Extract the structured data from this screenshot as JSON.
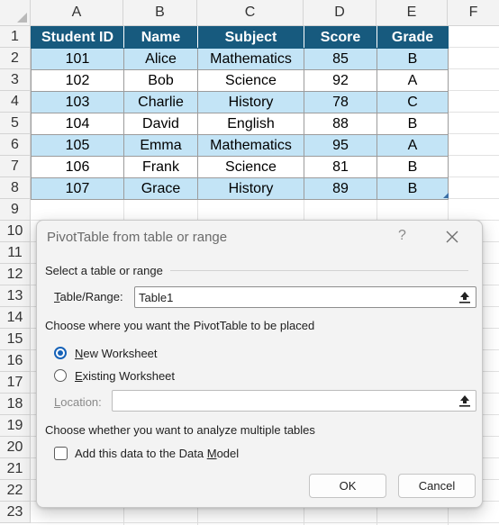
{
  "sheet": {
    "columns": [
      "A",
      "B",
      "C",
      "D",
      "E",
      "F"
    ],
    "rows": [
      "1",
      "2",
      "3",
      "4",
      "5",
      "6",
      "7",
      "8",
      "9",
      "10",
      "11",
      "12",
      "13",
      "14",
      "15",
      "16",
      "17",
      "18",
      "19",
      "20",
      "21",
      "22",
      "23"
    ]
  },
  "table": {
    "headers": [
      "Student ID",
      "Name",
      "Subject",
      "Score",
      "Grade"
    ],
    "rows": [
      [
        "101",
        "Alice",
        "Mathematics",
        "85",
        "B"
      ],
      [
        "102",
        "Bob",
        "Science",
        "92",
        "A"
      ],
      [
        "103",
        "Charlie",
        "History",
        "78",
        "C"
      ],
      [
        "104",
        "David",
        "English",
        "88",
        "B"
      ],
      [
        "105",
        "Emma",
        "Mathematics",
        "95",
        "A"
      ],
      [
        "106",
        "Frank",
        "Science",
        "81",
        "B"
      ],
      [
        "107",
        "Grace",
        "History",
        "89",
        "B"
      ]
    ],
    "header_color": "#175a7e",
    "band_color": "#c3e4f6"
  },
  "dialog": {
    "title": "PivotTable from table or range",
    "help": "?",
    "section_source": "Select a table or range",
    "table_range_label_pre": "",
    "table_range_label_key": "T",
    "table_range_label_post": "able/Range:",
    "table_range_value": "Table1",
    "section_placement": "Choose where you want the PivotTable to be placed",
    "new_ws_key": "N",
    "new_ws_rest": "ew Worksheet",
    "existing_ws_key": "E",
    "existing_ws_rest": "xisting Worksheet",
    "location_key": "L",
    "location_rest": "ocation:",
    "location_value": "",
    "section_multiple": "Choose whether you want to analyze multiple tables",
    "data_model_pre": "Add this data to the Data ",
    "data_model_key": "M",
    "data_model_post": "odel",
    "ok_label": "OK",
    "cancel_label": "Cancel",
    "placement_selected": "New Worksheet",
    "data_model_checked": false
  }
}
